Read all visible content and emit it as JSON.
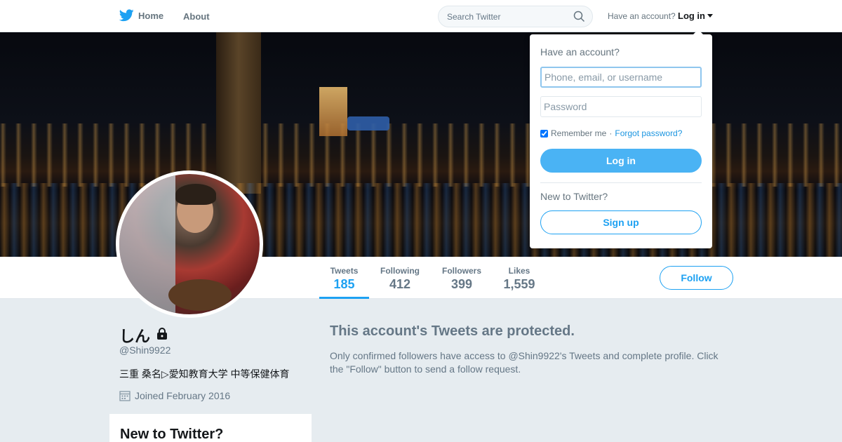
{
  "nav": {
    "home_label": "Home",
    "about_label": "About",
    "search_placeholder": "Search Twitter",
    "have_account": "Have an account?",
    "login_label": "Log in"
  },
  "profile": {
    "name": "しん",
    "handle": "@Shin9922",
    "bio": "三重 桑名▷愛知教育大学 中等保健体育",
    "joined": "Joined February 2016",
    "follow_label": "Follow"
  },
  "stats": [
    {
      "label": "Tweets",
      "value": "185",
      "active": true
    },
    {
      "label": "Following",
      "value": "412",
      "active": false
    },
    {
      "label": "Followers",
      "value": "399",
      "active": false
    },
    {
      "label": "Likes",
      "value": "1,559",
      "active": false
    }
  ],
  "protected": {
    "title": "This account's Tweets are protected.",
    "text": "Only confirmed followers have access to @Shin9922's Tweets and complete profile. Click the \"Follow\" button to send a follow request."
  },
  "sidebar": {
    "new_title": "New to Twitter?"
  },
  "login_dropdown": {
    "heading": "Have an account?",
    "username_placeholder": "Phone, email, or username",
    "password_placeholder": "Password",
    "remember_label": "Remember me",
    "separator": "·",
    "forgot_label": "Forgot password?",
    "login_button": "Log in",
    "new_label": "New to Twitter?",
    "signup_button": "Sign up"
  },
  "colors": {
    "accent": "#1da1f2",
    "login_button": "#4ab3f4",
    "background": "#e6ecf0"
  }
}
